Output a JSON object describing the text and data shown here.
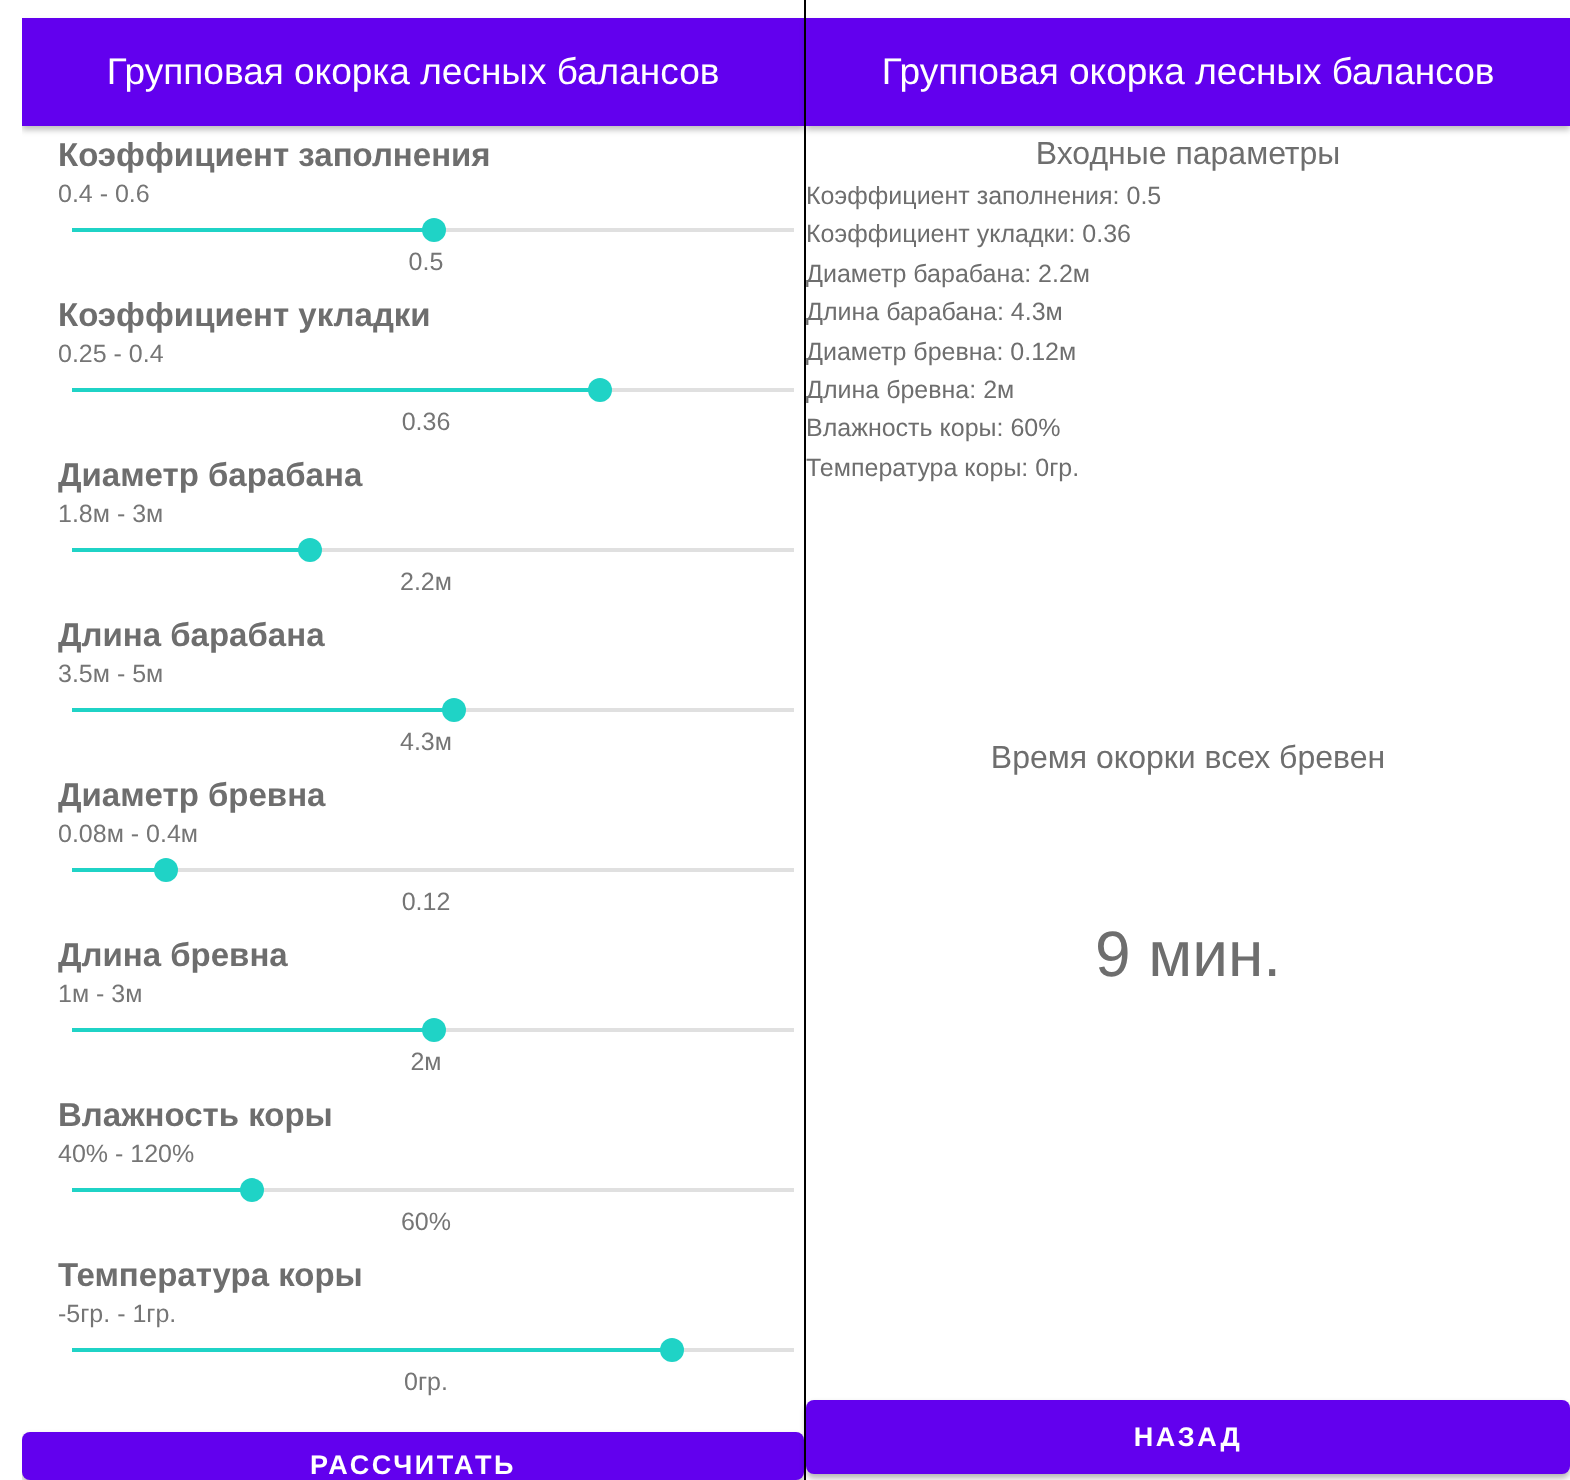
{
  "input_screen": {
    "title": "Групповая окорка лесных балансов",
    "sliders": [
      {
        "label": "Коэффициент заполнения",
        "range": "0.4 - 0.6",
        "level": 0.5,
        "reading": "0.5"
      },
      {
        "label": "Коэффициент укладки",
        "range": "0.25 - 0.4",
        "level": 0.73,
        "reading": "0.36"
      },
      {
        "label": "Диаметр барабана",
        "range": "1.8м - 3м",
        "level": 0.33,
        "reading": "2.2м"
      },
      {
        "label": "Длина барабана",
        "range": "3.5м - 5м",
        "level": 0.53,
        "reading": "4.3м"
      },
      {
        "label": "Диаметр бревна",
        "range": "0.08м - 0.4м",
        "level": 0.13,
        "reading": "0.12"
      },
      {
        "label": "Длина бревна",
        "range": "1м - 3м",
        "level": 0.5,
        "reading": "2м"
      },
      {
        "label": "Влажность коры",
        "range": "40% - 120%",
        "level": 0.25,
        "reading": "60%"
      },
      {
        "label": "Температура коры",
        "range": "-5гр. - 1гр.",
        "level": 0.83,
        "reading": "0гр."
      }
    ],
    "button": "РАССЧИТАТЬ"
  },
  "result_screen": {
    "title": "Групповая окорка лесных балансов",
    "params_heading": "Входные параметры",
    "params": [
      "Коэффициент заполнения: 0.5",
      "Коэффициент укладки: 0.36",
      "Диаметр барабана: 2.2м",
      "Длина барабана: 4.3м",
      "Диаметр бревна: 0.12м",
      "Длина бревна: 2м",
      "Влажность коры: 60%",
      "Температура коры: 0гр."
    ],
    "result_label": "Время окорки всех бревен",
    "result_value": "9 мин.",
    "button": "НАЗАД"
  }
}
